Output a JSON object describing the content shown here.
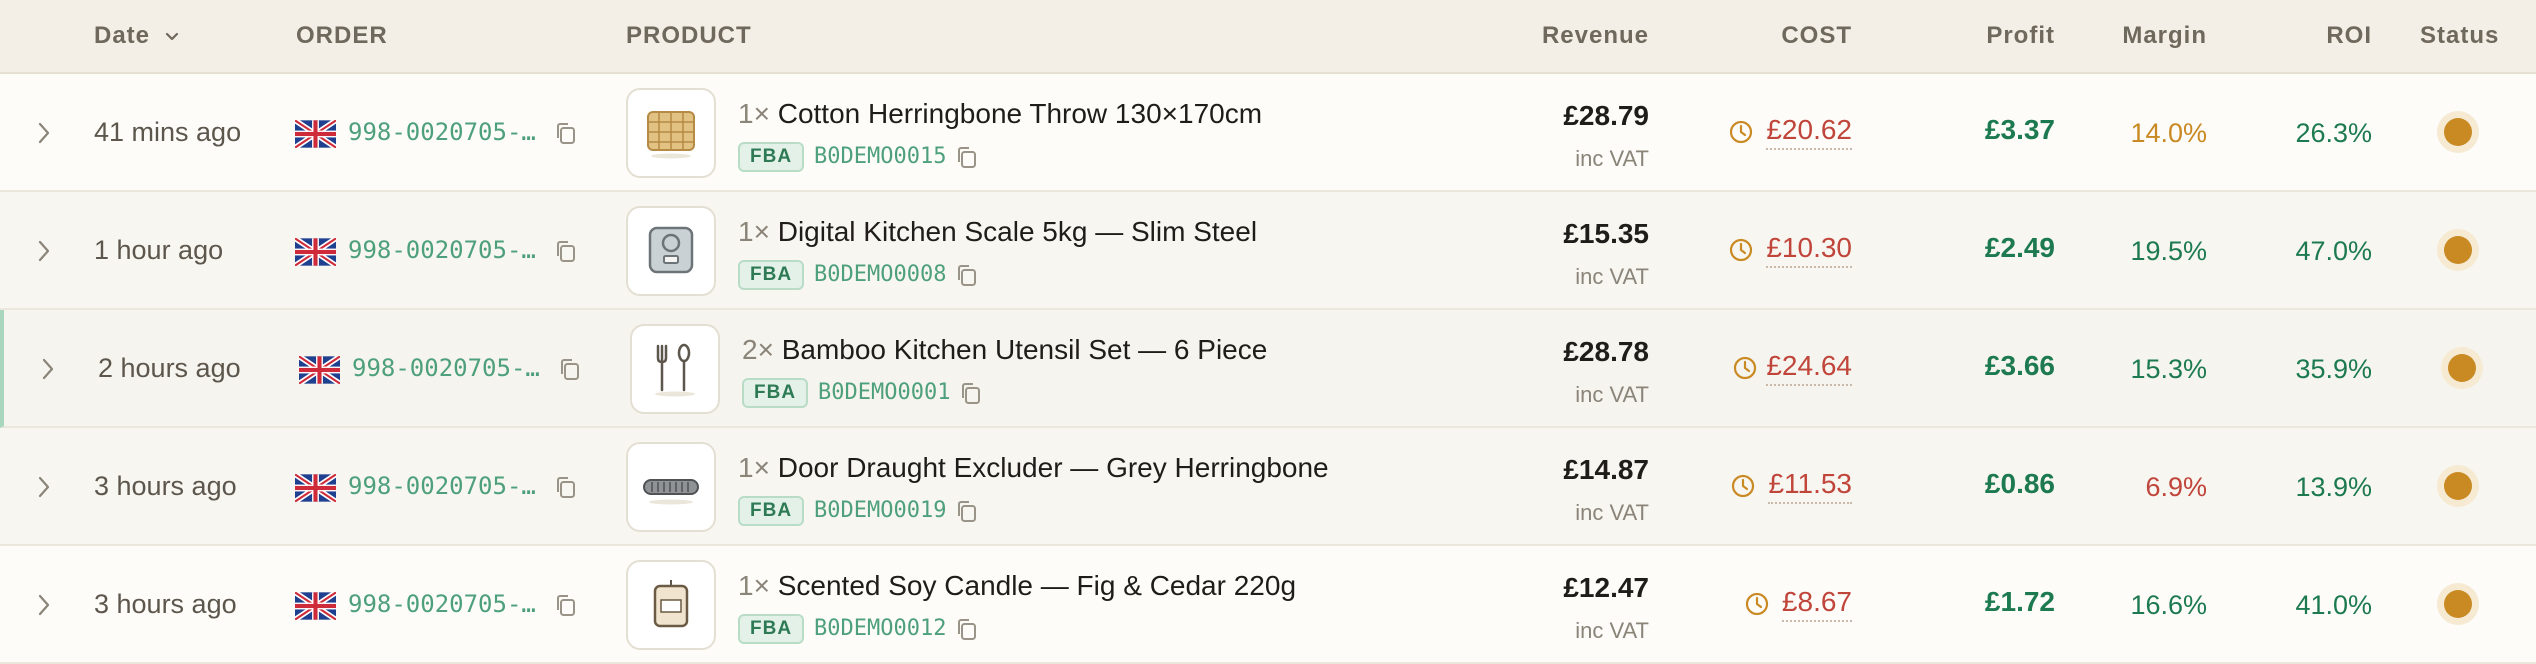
{
  "colors": {
    "accent_green": "#4ea07c",
    "profit_green": "#1d7a50",
    "cost_red": "#c0453a",
    "warning_amber": "#c98a23",
    "header_bg": "#f3efe6"
  },
  "header": {
    "date": "Date",
    "order": "ORDER",
    "product": "PRODUCT",
    "revenue": "Revenue",
    "cost": "COST",
    "profit": "Profit",
    "margin": "Margin",
    "roi": "ROI",
    "status": "Status"
  },
  "rows": [
    {
      "date": "41 mins ago",
      "country_flag": "uk-flag-icon",
      "order_id": "998-0020705-…",
      "qty": "1×",
      "product": "Cotton Herringbone Throw 130×170cm",
      "fulfillment": "FBA",
      "asin": "B0DEMO0015",
      "thumbnail": "throw-blanket-icon",
      "revenue": "£28.79",
      "vat_note": "inc VAT",
      "cost": "£20.62",
      "profit": "£3.37",
      "margin": "14.0%",
      "margin_color": "#c98a23",
      "roi": "26.3%",
      "status_color": "#c98a23"
    },
    {
      "date": "1 hour ago",
      "country_flag": "uk-flag-icon",
      "order_id": "998-0020705-…",
      "qty": "1×",
      "product": "Digital Kitchen Scale 5kg — Slim Steel",
      "fulfillment": "FBA",
      "asin": "B0DEMO0008",
      "thumbnail": "kitchen-scale-icon",
      "revenue": "£15.35",
      "vat_note": "inc VAT",
      "cost": "£10.30",
      "profit": "£2.49",
      "margin": "19.5%",
      "margin_color": "#1d7a50",
      "roi": "47.0%",
      "status_color": "#c98a23"
    },
    {
      "date": "2 hours ago",
      "country_flag": "uk-flag-icon",
      "order_id": "998-0020705-…",
      "qty": "2×",
      "product": "Bamboo Kitchen Utensil Set — 6 Piece",
      "fulfillment": "FBA",
      "asin": "B0DEMO0001",
      "thumbnail": "utensils-icon",
      "revenue": "£28.78",
      "vat_note": "inc VAT",
      "cost": "£24.64",
      "profit": "£3.66",
      "margin": "15.3%",
      "margin_color": "#1d7a50",
      "roi": "35.9%",
      "status_color": "#c98a23"
    },
    {
      "date": "3 hours ago",
      "country_flag": "uk-flag-icon",
      "order_id": "998-0020705-…",
      "qty": "1×",
      "product": "Door Draught Excluder — Grey Herringbone",
      "fulfillment": "FBA",
      "asin": "B0DEMO0019",
      "thumbnail": "draught-excluder-icon",
      "revenue": "£14.87",
      "vat_note": "inc VAT",
      "cost": "£11.53",
      "profit": "£0.86",
      "margin": "6.9%",
      "margin_color": "#c0453a",
      "roi": "13.9%",
      "status_color": "#c98a23"
    },
    {
      "date": "3 hours ago",
      "country_flag": "uk-flag-icon",
      "order_id": "998-0020705-…",
      "qty": "1×",
      "product": "Scented Soy Candle — Fig & Cedar 220g",
      "fulfillment": "FBA",
      "asin": "B0DEMO0012",
      "thumbnail": "candle-icon",
      "revenue": "£12.47",
      "vat_note": "inc VAT",
      "cost": "£8.67",
      "profit": "£1.72",
      "margin": "16.6%",
      "margin_color": "#1d7a50",
      "roi": "41.0%",
      "status_color": "#c98a23"
    }
  ]
}
